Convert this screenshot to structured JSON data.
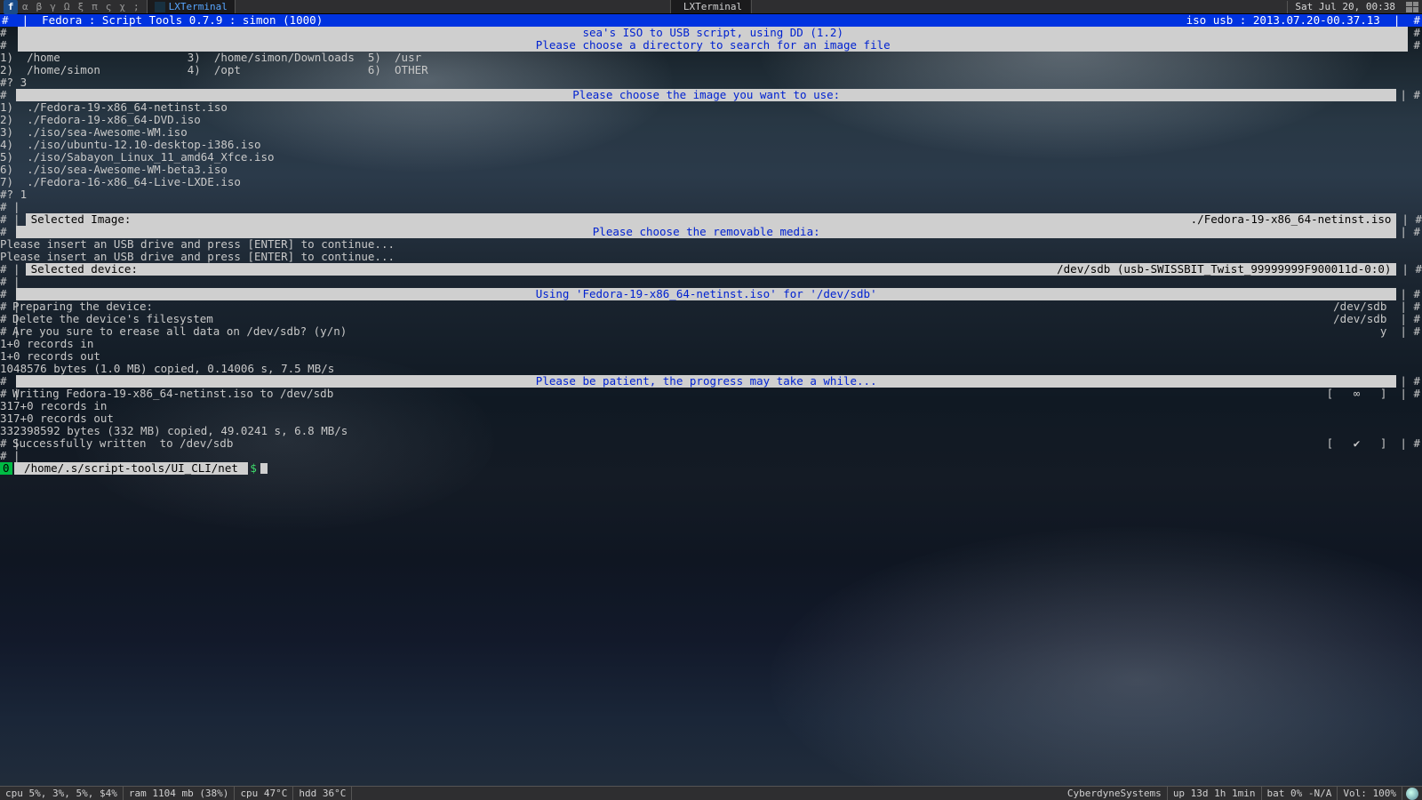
{
  "topbar": {
    "fedora_glyph": "f",
    "tags": [
      "α",
      "β",
      "γ",
      "Ω",
      "ξ",
      "π",
      "ς",
      "χ",
      ";"
    ],
    "task_active": "LXTerminal",
    "task_center": "LXTerminal",
    "clock": "Sat Jul 20, 00:38"
  },
  "headerbar": {
    "left": "Fedora : Script Tools 0.7.9 : simon (1000)",
    "right": "iso usb : 2013.07.20-00.37.13"
  },
  "banner1_line1": "sea's ISO to USB script, using DD (1.2)",
  "banner1_line2": "Please choose a directory to search for an image file",
  "dirmenu": {
    "row1": "1)  /home                   3)  /home/simon/Downloads  5)  /usr",
    "row2": "2)  /home/simon             4)  /opt                   6)  OTHER",
    "prompt": "#? 3"
  },
  "banner2": "Please choose the image you want to use:",
  "isos": [
    "1)  ./Fedora-19-x86_64-netinst.iso",
    "2)  ./Fedora-19-x86_64-DVD.iso",
    "3)  ./iso/sea-Awesome-WM.iso",
    "4)  ./iso/ubuntu-12.10-desktop-i386.iso",
    "5)  ./iso/Sabayon_Linux_11_amd64_Xfce.iso",
    "6)  ./iso/sea-Awesome-WM-beta3.iso",
    "7)  ./Fedora-16-x86_64-Live-LXDE.iso"
  ],
  "iso_prompt": "#? 1",
  "selected_image": {
    "label": "Selected Image:",
    "value": "./Fedora-19-x86_64-netinst.iso"
  },
  "banner3": "Please choose the removable media:",
  "insert_usb": "Please insert an USB drive and press [ENTER] to continue...",
  "selected_device": {
    "label": "Selected device:",
    "value": "/dev/sdb (usb-SWISSBIT_Twist_99999999F900011d-0:0)"
  },
  "banner4": "Using 'Fedora-19-x86_64-netinst.iso' for '/dev/sdb'",
  "prep": {
    "l1": "Preparing the device:",
    "r1": "/dev/sdb",
    "l2": "Delete the device's filesystem",
    "r2": "/dev/sdb",
    "l3": "Are you sure to erease all data on /dev/sdb? (y/n)",
    "r3": "y"
  },
  "dd1": [
    "1+0 records in",
    "1+0 records out",
    "1048576 bytes (1.0 MB) copied, 0.14006 s, 7.5 MB/s"
  ],
  "banner5": "Please be patient, the progress may take a while...",
  "writing": {
    "label": "Writing Fedora-19-x86_64-netinst.iso to /dev/sdb",
    "right": "[   ∞   ]"
  },
  "dd2": [
    "317+0 records in",
    "317+0 records out",
    "332398592 bytes (332 MB) copied, 49.0241 s, 6.8 MB/s"
  ],
  "success": "Successfully written  to /dev/sdb",
  "success_right": "[   ✔   ]",
  "prompt": {
    "exit": "0",
    "cwd": " /home/.s/script-tools/UI_CLI/net ",
    "sym": "$"
  },
  "bottombar": {
    "cpu": "cpu 5%, 3%, 5%, $4%",
    "ram": "ram 1104 mb (38%)",
    "cput": "cpu 47°C",
    "hdd": "hdd 36°C",
    "host": "CyberdyneSystems",
    "uptime": "up 13d 1h 1min",
    "bat": "bat 0% -N/A",
    "vol": "Vol: 100%"
  }
}
